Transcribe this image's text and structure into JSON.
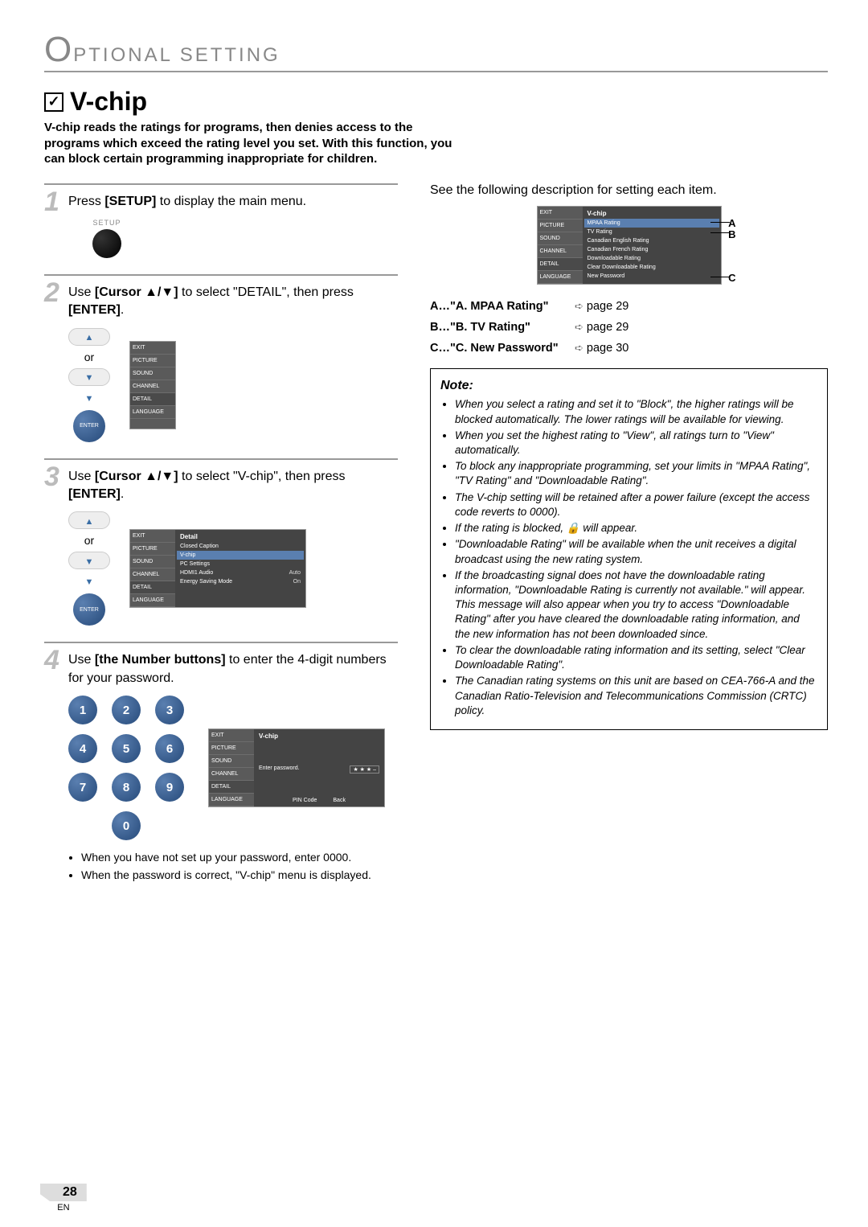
{
  "header": {
    "big_o": "O",
    "rest": "PTIONAL  SETTING"
  },
  "title": "V-chip",
  "intro": "V-chip reads the ratings for programs, then denies access to the programs which exceed the rating level you set. With this function, you can block certain programming inappropriate for children.",
  "steps": {
    "s1": {
      "num": "1",
      "text_pre": "Press ",
      "text_bold": "[SETUP]",
      "text_post": " to display the main menu.",
      "setup_label": "SETUP"
    },
    "s2": {
      "num": "2",
      "text_pre": "Use ",
      "text_bold": "[Cursor ▲/▼]",
      "text_mid": " to select \"DETAIL\", then press ",
      "text_bold2": "[ENTER]",
      "text_post": ".",
      "or": "or",
      "enter": "ENTER",
      "osd_side": [
        "EXIT",
        "PICTURE",
        "SOUND",
        "CHANNEL",
        "DETAIL",
        "LANGUAGE"
      ]
    },
    "s3": {
      "num": "3",
      "text_pre": "Use ",
      "text_bold": "[Cursor ▲/▼]",
      "text_mid": " to select \"V-chip\", then press ",
      "text_bold2": "[ENTER]",
      "text_post": ".",
      "or": "or",
      "enter": "ENTER",
      "osd_header": "Detail",
      "osd_rows": [
        {
          "l": "Closed Caption",
          "v": ""
        },
        {
          "l": "V-chip",
          "v": "",
          "hl": true
        },
        {
          "l": "PC Settings",
          "v": ""
        },
        {
          "l": "HDMI1 Audio",
          "v": "Auto"
        },
        {
          "l": "Energy Saving Mode",
          "v": "On"
        }
      ]
    },
    "s4": {
      "num": "4",
      "text_pre": "Use ",
      "text_bold": "[the Number buttons]",
      "text_post": " to enter the 4-digit numbers for your password.",
      "keys": [
        "1",
        "2",
        "3",
        "4",
        "5",
        "6",
        "7",
        "8",
        "9",
        "0"
      ],
      "osd_header": "V-chip",
      "osd_enter": "Enter password.",
      "stars": "★  ★  ★  –",
      "foot_pin": "PIN Code",
      "foot_back": "Back",
      "notes": [
        "When you have not set up your password, enter 0000.",
        "When the password is correct, \"V-chip\" menu is displayed."
      ]
    }
  },
  "right": {
    "intro": "See the following description for setting each item.",
    "osd_header": "V-chip",
    "osd_rows": [
      "MPAA Rating",
      "TV Rating",
      "Canadian English Rating",
      "Canadian French Rating",
      "Downloadable Rating",
      "Clear Downloadable Rating",
      "New Password"
    ],
    "callouts": {
      "a": "A",
      "b": "B",
      "c": "C"
    },
    "refs": [
      {
        "k": "A…",
        "t": "\"A. MPAA Rating\"",
        "p": "page 29"
      },
      {
        "k": "B…",
        "t": "\"B. TV Rating\"",
        "p": "page 29"
      },
      {
        "k": "C…",
        "t": "\"C. New Password\"",
        "p": "page 30"
      }
    ],
    "note_title": "Note:",
    "notes": [
      "When you select a rating and set it to \"Block\", the higher ratings will be blocked automatically. The lower ratings will be available for viewing.",
      "When you set the highest rating to \"View\", all ratings turn to \"View\" automatically.",
      "To block any inappropriate programming, set your limits in \"MPAA Rating\", \"TV Rating\" and \"Downloadable Rating\".",
      "The V-chip setting will be retained after a power failure (except the access code reverts to 0000).",
      "If the rating is blocked, 🔒 will appear.",
      "\"Downloadable Rating\" will be available when the unit receives a digital broadcast using the new rating system.",
      "If the broadcasting signal does not have the downloadable rating information, \"Downloadable Rating is currently not available.\" will appear. This message will also appear when you try to access \"Downloadable Rating\" after you have cleared the downloadable rating information, and the new information has not been downloaded since.",
      "To clear the downloadable rating information and its setting, select \"Clear Downloadable Rating\".",
      "The Canadian rating systems on this unit are based on CEA-766-A and the Canadian Ratio-Television and Telecommunications Commission (CRTC) policy."
    ]
  },
  "page": {
    "num": "28",
    "en": "EN"
  },
  "osd_side_labels": [
    "EXIT",
    "PICTURE",
    "SOUND",
    "CHANNEL",
    "DETAIL",
    "LANGUAGE"
  ]
}
